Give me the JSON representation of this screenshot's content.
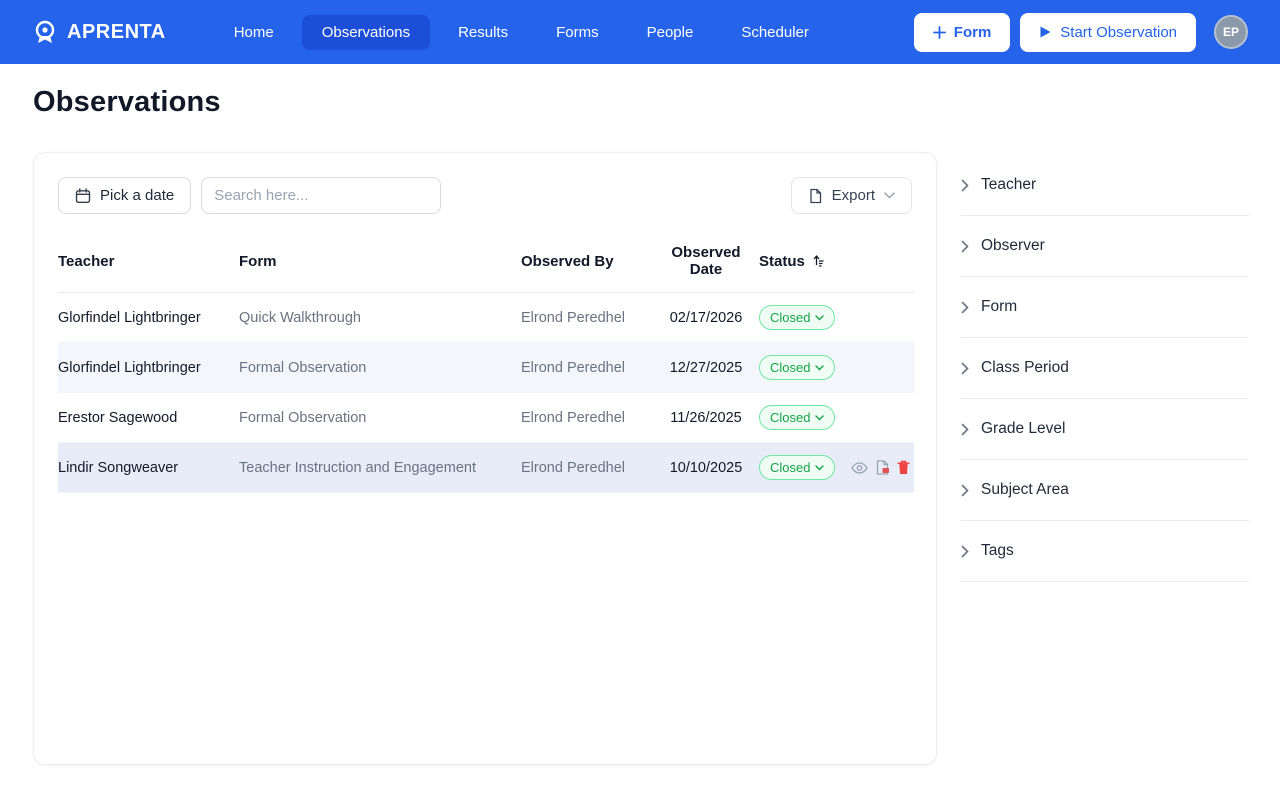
{
  "navbar": {
    "brand": "APRENTA",
    "items": [
      {
        "label": "Home"
      },
      {
        "label": "Observations"
      },
      {
        "label": "Results"
      },
      {
        "label": "Forms"
      },
      {
        "label": "People"
      },
      {
        "label": "Scheduler"
      }
    ],
    "form_button": "Form",
    "start_button": "Start Observation",
    "avatar_initials": "EP"
  },
  "page": {
    "title": "Observations"
  },
  "toolbar": {
    "pick_date": "Pick a date",
    "search_placeholder": "Search here...",
    "export": "Export"
  },
  "table": {
    "headers": {
      "teacher": "Teacher",
      "form": "Form",
      "observed_by": "Observed By",
      "observed_date": "Observed Date",
      "status": "Status"
    },
    "rows": [
      {
        "teacher": "Glorfindel Lightbringer",
        "form": "Quick Walkthrough",
        "observed_by": "Elrond Peredhel",
        "date": "02/17/2026",
        "status": "Closed"
      },
      {
        "teacher": "Glorfindel Lightbringer",
        "form": "Formal Observation",
        "observed_by": "Elrond Peredhel",
        "date": "12/27/2025",
        "status": "Closed"
      },
      {
        "teacher": "Erestor Sagewood",
        "form": "Formal Observation",
        "observed_by": "Elrond Peredhel",
        "date": "11/26/2025",
        "status": "Closed"
      },
      {
        "teacher": "Lindir Songweaver",
        "form": "Teacher Instruction and Engagement",
        "observed_by": "Elrond Peredhel",
        "date": "10/10/2025",
        "status": "Closed"
      }
    ]
  },
  "filters": [
    "Teacher",
    "Observer",
    "Form",
    "Class Period",
    "Grade Level",
    "Subject Area",
    "Tags"
  ],
  "colors": {
    "navbar": "#2563eb",
    "navbar_active": "#1d4ed8",
    "accent_blue": "#2563eb",
    "status_green": "#16a34a",
    "danger_red": "#ef4444"
  }
}
